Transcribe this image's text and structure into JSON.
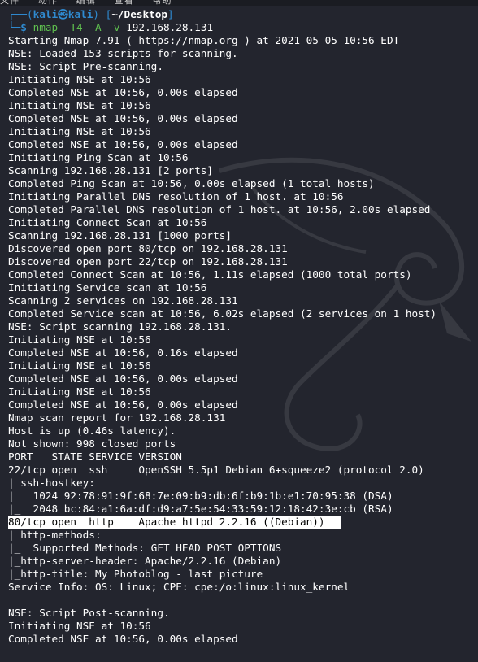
{
  "top_strip": "文件   动作   编辑   查看   帮助",
  "prompt": {
    "user_host": "kali㉿kali",
    "path": "~/Desktop",
    "command": "nmap",
    "options": "-T4 -A -v",
    "target": "192.168.28.131"
  },
  "lines": [
    "Starting Nmap 7.91 ( https://nmap.org ) at 2021-05-05 10:56 EDT",
    "NSE: Loaded 153 scripts for scanning.",
    "NSE: Script Pre-scanning.",
    "Initiating NSE at 10:56",
    "Completed NSE at 10:56, 0.00s elapsed",
    "Initiating NSE at 10:56",
    "Completed NSE at 10:56, 0.00s elapsed",
    "Initiating NSE at 10:56",
    "Completed NSE at 10:56, 0.00s elapsed",
    "Initiating Ping Scan at 10:56",
    "Scanning 192.168.28.131 [2 ports]",
    "Completed Ping Scan at 10:56, 0.00s elapsed (1 total hosts)",
    "Initiating Parallel DNS resolution of 1 host. at 10:56",
    "Completed Parallel DNS resolution of 1 host. at 10:56, 2.00s elapsed",
    "Initiating Connect Scan at 10:56",
    "Scanning 192.168.28.131 [1000 ports]",
    "Discovered open port 80/tcp on 192.168.28.131",
    "Discovered open port 22/tcp on 192.168.28.131",
    "Completed Connect Scan at 10:56, 1.11s elapsed (1000 total ports)",
    "Initiating Service scan at 10:56",
    "Scanning 2 services on 192.168.28.131",
    "Completed Service scan at 10:56, 6.02s elapsed (2 services on 1 host)",
    "NSE: Script scanning 192.168.28.131.",
    "Initiating NSE at 10:56",
    "Completed NSE at 10:56, 0.16s elapsed",
    "Initiating NSE at 10:56",
    "Completed NSE at 10:56, 0.00s elapsed",
    "Initiating NSE at 10:56",
    "Completed NSE at 10:56, 0.00s elapsed",
    "Nmap scan report for 192.168.28.131",
    "Host is up (0.46s latency).",
    "Not shown: 998 closed ports",
    "PORT   STATE SERVICE VERSION",
    "22/tcp open  ssh     OpenSSH 5.5p1 Debian 6+squeeze2 (protocol 2.0)",
    "| ssh-hostkey: ",
    "|   1024 92:78:91:9f:68:7e:09:b9:db:6f:b9:1b:e1:70:95:38 (DSA)",
    "|_  2048 bc:84:a1:6a:df:d9:a7:5e:54:33:59:12:18:42:3e:cb (RSA)",
    "80/tcp open  http    Apache httpd 2.2.16 ((Debian))",
    "| http-methods: ",
    "|_  Supported Methods: GET HEAD POST OPTIONS",
    "|_http-server-header: Apache/2.2.16 (Debian)",
    "|_http-title: My Photoblog - last picture",
    "Service Info: OS: Linux; CPE: cpe:/o:linux:linux_kernel",
    "",
    "NSE: Script Post-scanning.",
    "Initiating NSE at 10:56",
    "Completed NSE at 10:56, 0.00s elapsed"
  ],
  "highlighted_line_index": 37,
  "colors": {
    "background": "#23252e",
    "prompt_blue": "#2f8bd1",
    "command_green": "#5fbf4f",
    "highlight_bg": "#ffffff",
    "highlight_fg": "#000000"
  },
  "decoration": "kali-dragon-watermark"
}
